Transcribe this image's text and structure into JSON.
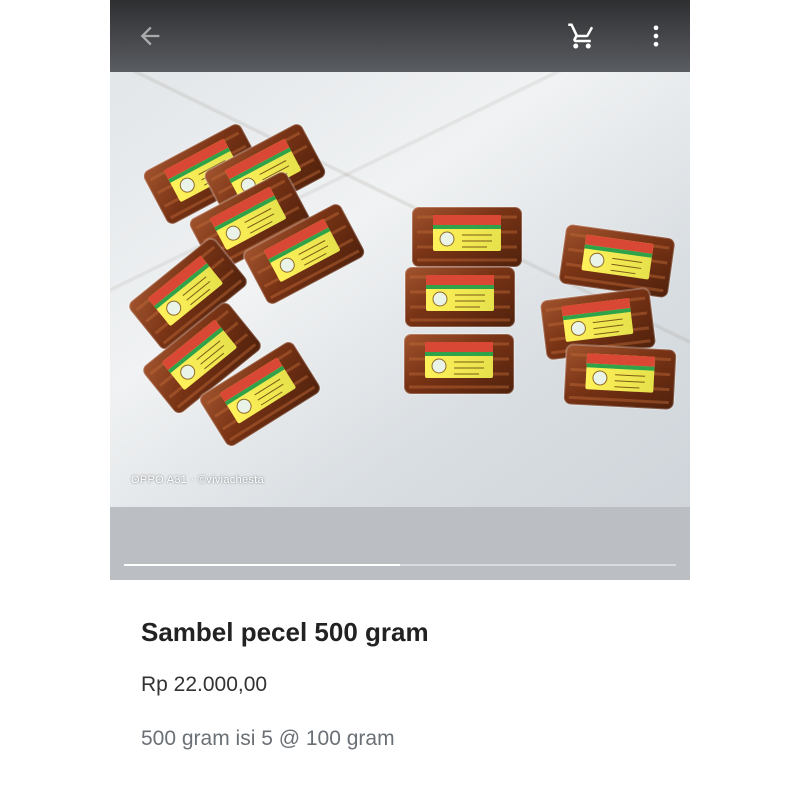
{
  "app": {
    "accent_color": "#ffffff",
    "toolbar_color": "#3f4144"
  },
  "toolbar": {
    "back_icon": "arrow-left-icon",
    "cart_icon": "shopping-cart-icon",
    "more_icon": "more-vert-icon"
  },
  "gallery": {
    "image_description": "Packaged sambal pecel blocks with Mbak Ti labels on a tiled floor",
    "watermark": "OPPO A31 · ©viviachesta",
    "progress_fraction": 0.5
  },
  "product": {
    "title": "Sambel pecel 500 gram",
    "price": "Rp 22.000,00",
    "description": "500 gram isi 5 @ 100 gram"
  }
}
